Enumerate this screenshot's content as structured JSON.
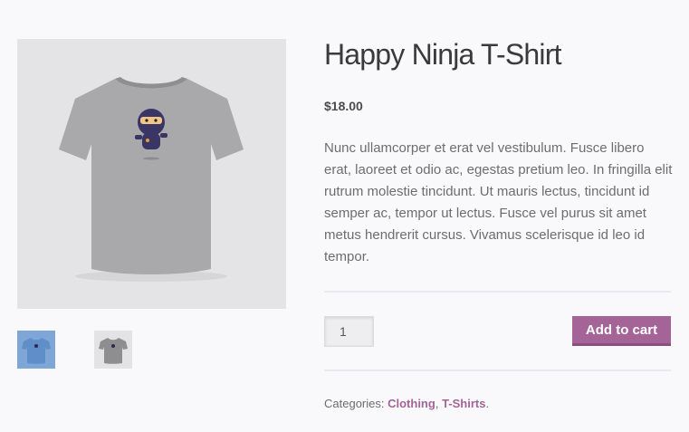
{
  "product": {
    "title": "Happy Ninja T-Shirt",
    "price": "$18.00",
    "description": "Nunc ullamcorper et erat vel vestibulum. Fusce libero erat, laoreet et odio ac, egestas pretium leo. In fringilla elit rutrum molestie tincidunt. Ut mauris lectus, tincidunt id semper ac, tempor ut lectus. Fusce vel purus sit amet metus hendrerit cursus. Vivamus scelerisque id leo id tempor."
  },
  "cart": {
    "quantity": "1",
    "add_label": "Add to cart"
  },
  "meta": {
    "categories_label": "Categories:",
    "categories": [
      "Clothing",
      "T-Shirts"
    ],
    "separator": ",",
    "end": "."
  },
  "colors": {
    "accent": "#a46497",
    "title": "#3a3a3a",
    "body_text": "#6d6d6d",
    "background": "#f9f9fb"
  },
  "gallery": {
    "main_image": "grey-ninja-tshirt",
    "thumbnails": [
      "blue-ninja-tshirt",
      "grey-ninja-tshirt"
    ]
  }
}
